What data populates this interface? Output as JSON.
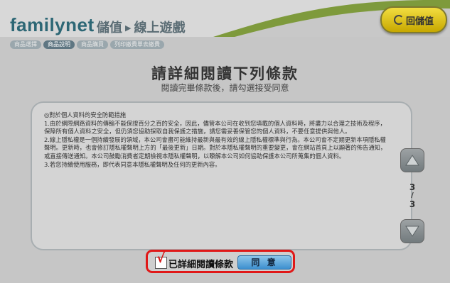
{
  "header": {
    "brand": "familynet",
    "crumb_part1": "儲值",
    "crumb_part2": "線上遊戲",
    "back_label": "回儲值"
  },
  "steps": [
    "商品選擇",
    "商品說明",
    "商品購買",
    "列印繳費單去繳費"
  ],
  "active_step_index": 1,
  "title": "請詳細閱讀下列條款",
  "subtitle": "閱讀完畢條款後，請勾選接受同意",
  "terms": {
    "heading": "◎對於個人資料的安全防範措施",
    "paragraphs": [
      "1.由於網際網路資料的傳輸不能保證百分之百的安全，因此，儘管本公司在收到您填載的個人資料時，將盡力以合理之技術及程序，保障所有個人資料之安全，但仍須您協助採取自我保護之措施，請您需妥善保管您的個人資料，不要任意提供與他人。",
      "2.線上隱私權是一個持續發展的領域，本公司會盡可能維持最新與最有效的線上隱私權標準與行為。本公司會不定期更新本項隱私權聲明。更新時，也會修訂隱私權聲明上方的「最後更新」日期。對於本隱私權聲明的重要變更，會在網站首頁上以顯著的佈告通知，或直接傳送通知。本公司鼓勵消費者定期檢視本隱私權聲明，以瞭解本公司如何協助保護本公司所蒐集的個人資料。",
      "3.若您持續使用服務，即代表同意本隱私權聲明及任何的更新內容。"
    ]
  },
  "pager": {
    "current": "3",
    "separator": "/",
    "total": "3"
  },
  "agree": {
    "checked": true,
    "checkmark": "√",
    "label": "已詳細閱讀條款",
    "button_label": "同 意"
  },
  "colors": {
    "overlay": "#c6c6c6",
    "brand": "#2d6775",
    "highlight_border": "#e01818",
    "agree_button": "#4a9ad8",
    "back_button": "#d8bf10"
  }
}
